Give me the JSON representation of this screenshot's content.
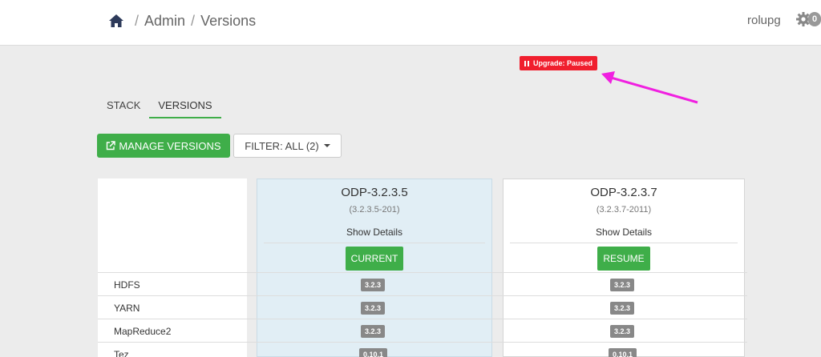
{
  "breadcrumb": {
    "admin": "Admin",
    "sep": "/",
    "current": "Versions"
  },
  "user": {
    "name": "rolupg"
  },
  "alerts": {
    "count": "0"
  },
  "upgrade_status": {
    "label": "Upgrade: Paused"
  },
  "tabs": [
    {
      "label": "STACK",
      "active": false
    },
    {
      "label": "VERSIONS",
      "active": true
    }
  ],
  "buttons": {
    "manage_versions": "MANAGE VERSIONS",
    "filter": "FILTER: ALL (2)"
  },
  "versions": [
    {
      "name": "ODP-3.2.3.5",
      "build": "(3.2.3.5-201)",
      "details": "Show Details",
      "action": "CURRENT"
    },
    {
      "name": "ODP-3.2.3.7",
      "build": "(3.2.3.7-2011)",
      "details": "Show Details",
      "action": "RESUME"
    }
  ],
  "services": [
    {
      "name": "HDFS",
      "current": "3.2.3",
      "target": "3.2.3"
    },
    {
      "name": "YARN",
      "current": "3.2.3",
      "target": "3.2.3"
    },
    {
      "name": "MapReduce2",
      "current": "3.2.3",
      "target": "3.2.3"
    },
    {
      "name": "Tez",
      "current": "0.10.1",
      "target": "0.10.1"
    }
  ],
  "colors": {
    "accent": "#3fae49",
    "alert": "#f01f2e",
    "annotation": "#f020e0",
    "current_col": "#e1eef5"
  },
  "icons": {
    "home": "home-icon",
    "settings": "gear-icon",
    "pause": "pause-icon",
    "external": "external-link-icon",
    "caret": "caret-down-icon"
  }
}
